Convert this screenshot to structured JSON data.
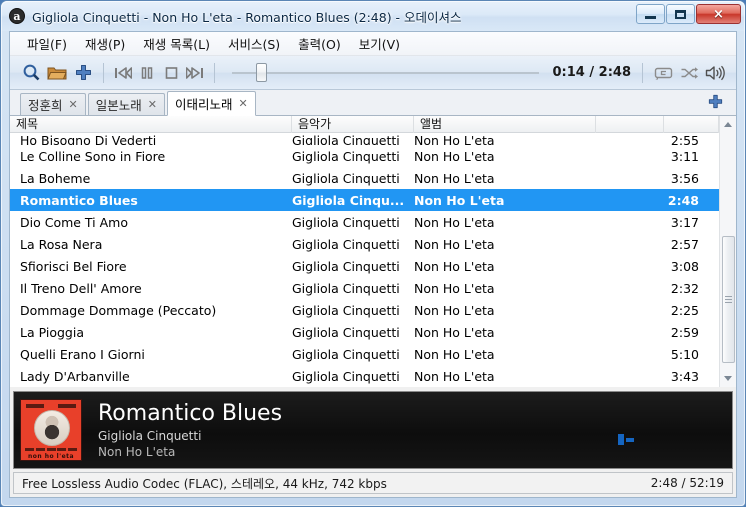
{
  "window": {
    "title": "Gigliola Cinquetti - Non Ho L'eta - Romantico Blues (2:48) - 오데이셔스",
    "app_icon": "audacious-icon",
    "minimize_label": "최소화",
    "maximize_label": "최대화",
    "close_label": "×"
  },
  "menubar": [
    {
      "label": "파일(F)"
    },
    {
      "label": "재생(P)"
    },
    {
      "label": "재생 목록(L)"
    },
    {
      "label": "서비스(S)"
    },
    {
      "label": "출력(O)"
    },
    {
      "label": "보기(V)"
    }
  ],
  "toolbar": {
    "search_icon": "search-icon",
    "open_icon": "folder-open-icon",
    "add_icon": "plus-icon",
    "previous_icon": "previous-track-icon",
    "playpause_icon": "pause-icon",
    "stop_icon": "stop-icon",
    "next_icon": "next-track-icon",
    "time_label": "0:14 / 2:48",
    "repeat_icon": "repeat-icon",
    "shuffle_icon": "shuffle-icon",
    "volume_icon": "volume-icon"
  },
  "tabs": {
    "items": [
      {
        "label": "정훈희",
        "close": "✕",
        "active": false
      },
      {
        "label": "일본노래",
        "close": "✕",
        "active": false
      },
      {
        "label": "이태리노래",
        "close": "✕",
        "active": true
      }
    ],
    "add_tab_icon": "plus-icon"
  },
  "playlist": {
    "columns": [
      "제목",
      "음악가",
      "앨범",
      "",
      ""
    ],
    "rows": [
      {
        "title": "Ho Bisogno Di Vederti",
        "artist": "Gigliola Cinquetti",
        "album": "Non Ho L'eta",
        "length": "2:55",
        "selected": false,
        "clipped": true
      },
      {
        "title": "Le Colline Sono in Fiore",
        "artist": "Gigliola Cinquetti",
        "album": "Non Ho L'eta",
        "length": "3:11",
        "selected": false
      },
      {
        "title": "La Boheme",
        "artist": "Gigliola Cinquetti",
        "album": "Non Ho L'eta",
        "length": "3:56",
        "selected": false
      },
      {
        "title": "Romantico Blues",
        "artist": "Gigliola Cinqu...",
        "album": "Non Ho L'eta",
        "length": "2:48",
        "selected": true
      },
      {
        "title": "Dio Come Ti Amo",
        "artist": "Gigliola Cinquetti",
        "album": "Non Ho L'eta",
        "length": "3:17",
        "selected": false
      },
      {
        "title": "La Rosa Nera",
        "artist": "Gigliola Cinquetti",
        "album": "Non Ho L'eta",
        "length": "2:57",
        "selected": false
      },
      {
        "title": "Sfiorisci Bel Fiore",
        "artist": "Gigliola Cinquetti",
        "album": "Non Ho L'eta",
        "length": "3:08",
        "selected": false
      },
      {
        "title": "Il Treno Dell' Amore",
        "artist": "Gigliola Cinquetti",
        "album": "Non Ho L'eta",
        "length": "2:32",
        "selected": false
      },
      {
        "title": "Dommage Dommage (Peccato)",
        "artist": "Gigliola Cinquetti",
        "album": "Non Ho L'eta",
        "length": "2:25",
        "selected": false
      },
      {
        "title": "La Pioggia",
        "artist": "Gigliola Cinquetti",
        "album": "Non Ho L'eta",
        "length": "2:59",
        "selected": false
      },
      {
        "title": "Quelli Erano I Giorni",
        "artist": "Gigliola Cinquetti",
        "album": "Non Ho L'eta",
        "length": "5:10",
        "selected": false
      },
      {
        "title": "Lady D'Arbanville",
        "artist": "Gigliola Cinquetti",
        "album": "Non Ho L'eta",
        "length": "3:43",
        "selected": false
      }
    ],
    "scrollbar": {
      "up_icon": "scroll-up-icon",
      "down_icon": "scroll-down-icon"
    }
  },
  "now_playing": {
    "cover_alt": "album-art-non-ho-leta",
    "cover_caption": "non ho l'eta",
    "title": "Romantico Blues",
    "artist": "Gigliola Cinquetti",
    "album": "Non Ho L'eta",
    "visualizer": "audio-visualizer"
  },
  "statusbar": {
    "codec": "Free Lossless Audio Codec (FLAC), 스테레오, 44 kHz, 742 kbps",
    "totals": "2:48 / 52:19"
  },
  "colors": {
    "selection": "#2196f3",
    "accent": "#1565c0",
    "cover_red": "#e8402a"
  }
}
